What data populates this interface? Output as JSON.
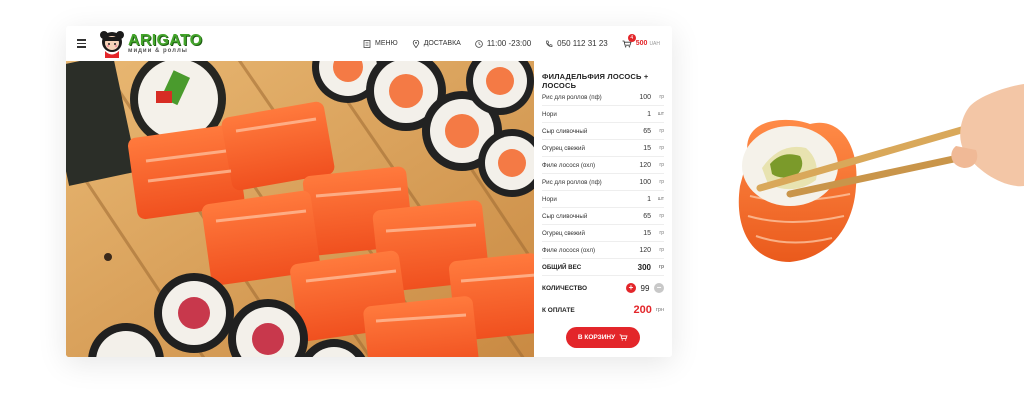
{
  "header": {
    "logo": {
      "brand": "ARIGATO",
      "tagline": "мидии & роллы"
    },
    "nav": [
      {
        "key": "menu",
        "label": "МЕНЮ",
        "icon": "menu-book-icon"
      },
      {
        "key": "delivery",
        "label": "ДОСТАВКА",
        "icon": "location-pin-icon"
      },
      {
        "key": "hours",
        "label": "11:00 -23:00",
        "icon": "clock-icon"
      },
      {
        "key": "phone",
        "label": "050 112 31 23",
        "icon": "phone-icon"
      }
    ],
    "cart": {
      "count": "4",
      "price": "500",
      "currency": "UAH",
      "icon": "cart-icon"
    }
  },
  "product": {
    "title": "ФИЛАДЕЛЬФИЯ ЛОСОСЬ + ЛОСОСЬ",
    "ingredients": [
      {
        "name": "Рис для роллов (пф)",
        "amount": "100",
        "unit": "гр"
      },
      {
        "name": "Нори",
        "amount": "1",
        "unit": "шт"
      },
      {
        "name": "Сыр сливочный",
        "amount": "65",
        "unit": "гр"
      },
      {
        "name": "Огурец свежий",
        "amount": "15",
        "unit": "гр"
      },
      {
        "name": "Филе лосося (охл)",
        "amount": "120",
        "unit": "гр"
      },
      {
        "name": "Рис для роллов (пф)",
        "amount": "100",
        "unit": "гр"
      },
      {
        "name": "Нори",
        "amount": "1",
        "unit": "шт"
      },
      {
        "name": "Сыр сливочный",
        "amount": "65",
        "unit": "гр"
      },
      {
        "name": "Огурец свежий",
        "amount": "15",
        "unit": "гр"
      },
      {
        "name": "Филе лосося (охл)",
        "amount": "120",
        "unit": "гр"
      }
    ],
    "total_weight": {
      "label": "ОБЩИЙ ВЕС",
      "amount": "300",
      "unit": "гр"
    },
    "quantity": {
      "label": "КОЛИЧЕСТВО",
      "value": "99"
    },
    "payment": {
      "label": "К ОПЛАТЕ",
      "amount": "200",
      "currency": "грн"
    },
    "cta": {
      "label": "В КОРЗИНУ",
      "icon": "cart-icon"
    }
  },
  "colors": {
    "accent": "#e3262a",
    "brand_green": "#44a52b"
  }
}
